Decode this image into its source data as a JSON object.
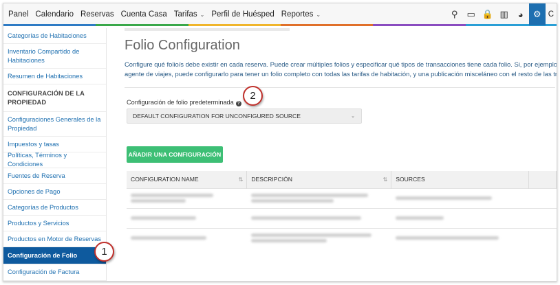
{
  "nav": {
    "items": [
      {
        "label": "Panel",
        "dropdown": false
      },
      {
        "label": "Calendario",
        "dropdown": false
      },
      {
        "label": "Reservas",
        "dropdown": false
      },
      {
        "label": "Cuenta Casa",
        "dropdown": false
      },
      {
        "label": "Tarifas",
        "dropdown": true
      },
      {
        "label": "Perfil de Huésped",
        "dropdown": false
      },
      {
        "label": "Reportes",
        "dropdown": true
      }
    ],
    "chevron": "⌄",
    "user_initial": "C",
    "accent_stripe": [
      "#2e7bc4",
      "#3aa84a",
      "#f0b52b",
      "#e0702a",
      "#8a4cc0",
      "#2a9fd6"
    ],
    "active_tool_color": "#1d6fb0",
    "tools": [
      {
        "icon": "search-icon",
        "glyph": "⚲"
      },
      {
        "icon": "cash-icon",
        "glyph": "▭"
      },
      {
        "icon": "lock-icon",
        "glyph": "🔒"
      },
      {
        "icon": "building-icon",
        "glyph": "▥"
      },
      {
        "icon": "pie-chart-icon",
        "glyph": "◕"
      },
      {
        "icon": "gear-icon",
        "glyph": "⚙"
      }
    ]
  },
  "sidebar": {
    "items": [
      {
        "label": "Categorías de Habitaciones",
        "type": "link"
      },
      {
        "label": "Inventario Compartido de Habitaciones",
        "type": "link"
      },
      {
        "label": "Resumen de Habitaciones",
        "type": "link"
      },
      {
        "label": "CONFIGURACIÓN DE LA PROPIEDAD",
        "type": "header"
      },
      {
        "label": "Configuraciones Generales de la Propiedad",
        "type": "link"
      },
      {
        "label": "Impuestos y tasas",
        "type": "link"
      },
      {
        "label": "Políticas, Términos y Condiciones",
        "type": "link"
      },
      {
        "label": "Fuentes de Reserva",
        "type": "link"
      },
      {
        "label": "Opciones de Pago",
        "type": "link"
      },
      {
        "label": "Categorías de Productos",
        "type": "link"
      },
      {
        "label": "Productos y Servicios",
        "type": "link"
      },
      {
        "label": "Productos en Motor de Reservas",
        "type": "link"
      },
      {
        "label": "Configuración de Folio",
        "type": "active"
      },
      {
        "label": "Configuración de Factura",
        "type": "link"
      }
    ]
  },
  "main": {
    "title": "Folio Configuration",
    "description_line1": "Configure qué folio/s debe existir en cada reserva. Puede crear múltiples folios y especificar qué tipos de transacciones tiene cada folio. Si, por ejemplo, tr",
    "description_line2": "agente de viajes, puede configurarlo para tener un folio completo con todas las tarifas de habitación, y una publicación misceláneo con el resto de las trar",
    "default_config_label": "Configuración de folio predeterminada",
    "help_glyph": "?",
    "default_config_value": "DEFAULT CONFIGURATION FOR UNCONFIGURED SOURCE",
    "select_caret": "⌄",
    "add_button": "AÑADIR UNA CONFIGURACIÓN",
    "table": {
      "columns": [
        "CONFIGURATION NAME",
        "DESCRIPCIÓN",
        "SOURCES"
      ],
      "sort_glyph": "⇅",
      "rows_count_note": "blurred"
    }
  },
  "annotations": {
    "badge_1": "1",
    "badge_2": "2",
    "badge_color": "#c0302b"
  }
}
